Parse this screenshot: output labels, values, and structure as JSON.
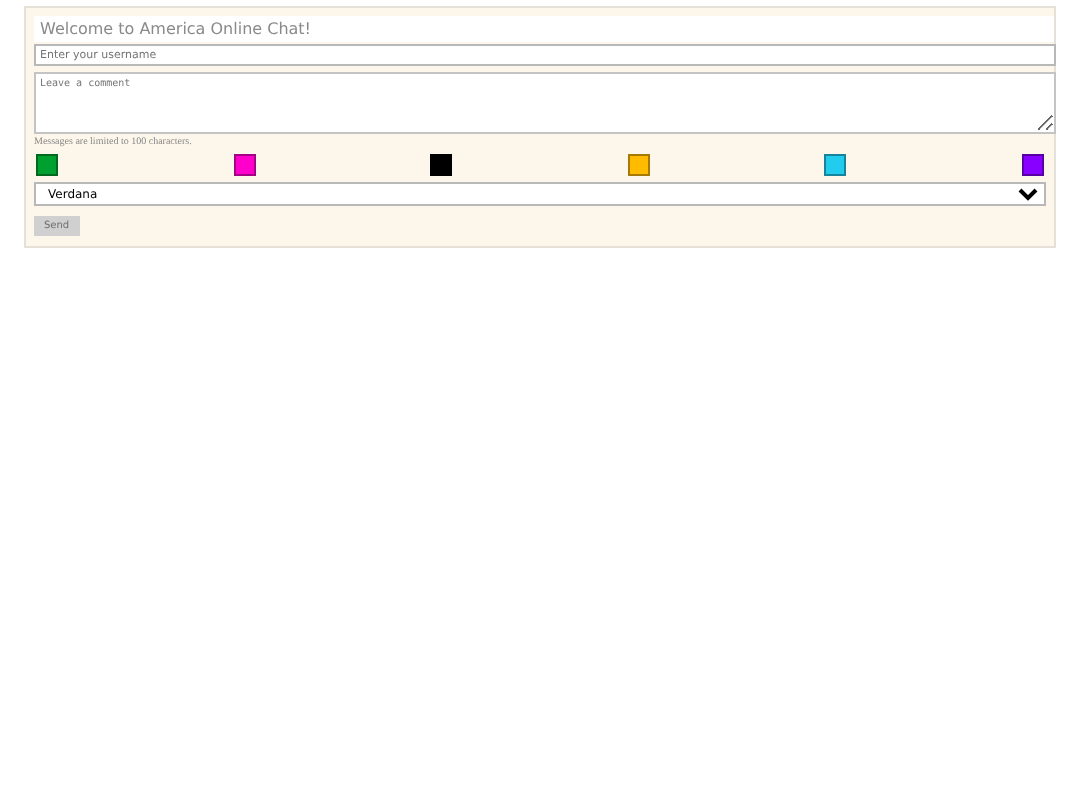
{
  "chat": {
    "title": "Welcome to America Online Chat!",
    "username": {
      "placeholder": "Enter your username"
    },
    "comment": {
      "placeholder": "Leave a comment"
    },
    "note": "Messages are limited to 100 characters.",
    "colors": [
      {
        "color": "#00a030"
      },
      {
        "color": "#ff00cc"
      },
      {
        "color": "#000000"
      },
      {
        "color": "#ffbb00"
      },
      {
        "color": "#22ccee"
      },
      {
        "color": "#8800ff"
      }
    ],
    "font_select": {
      "value": "Verdana"
    },
    "send": {
      "label": "Send",
      "disabled": true
    }
  }
}
